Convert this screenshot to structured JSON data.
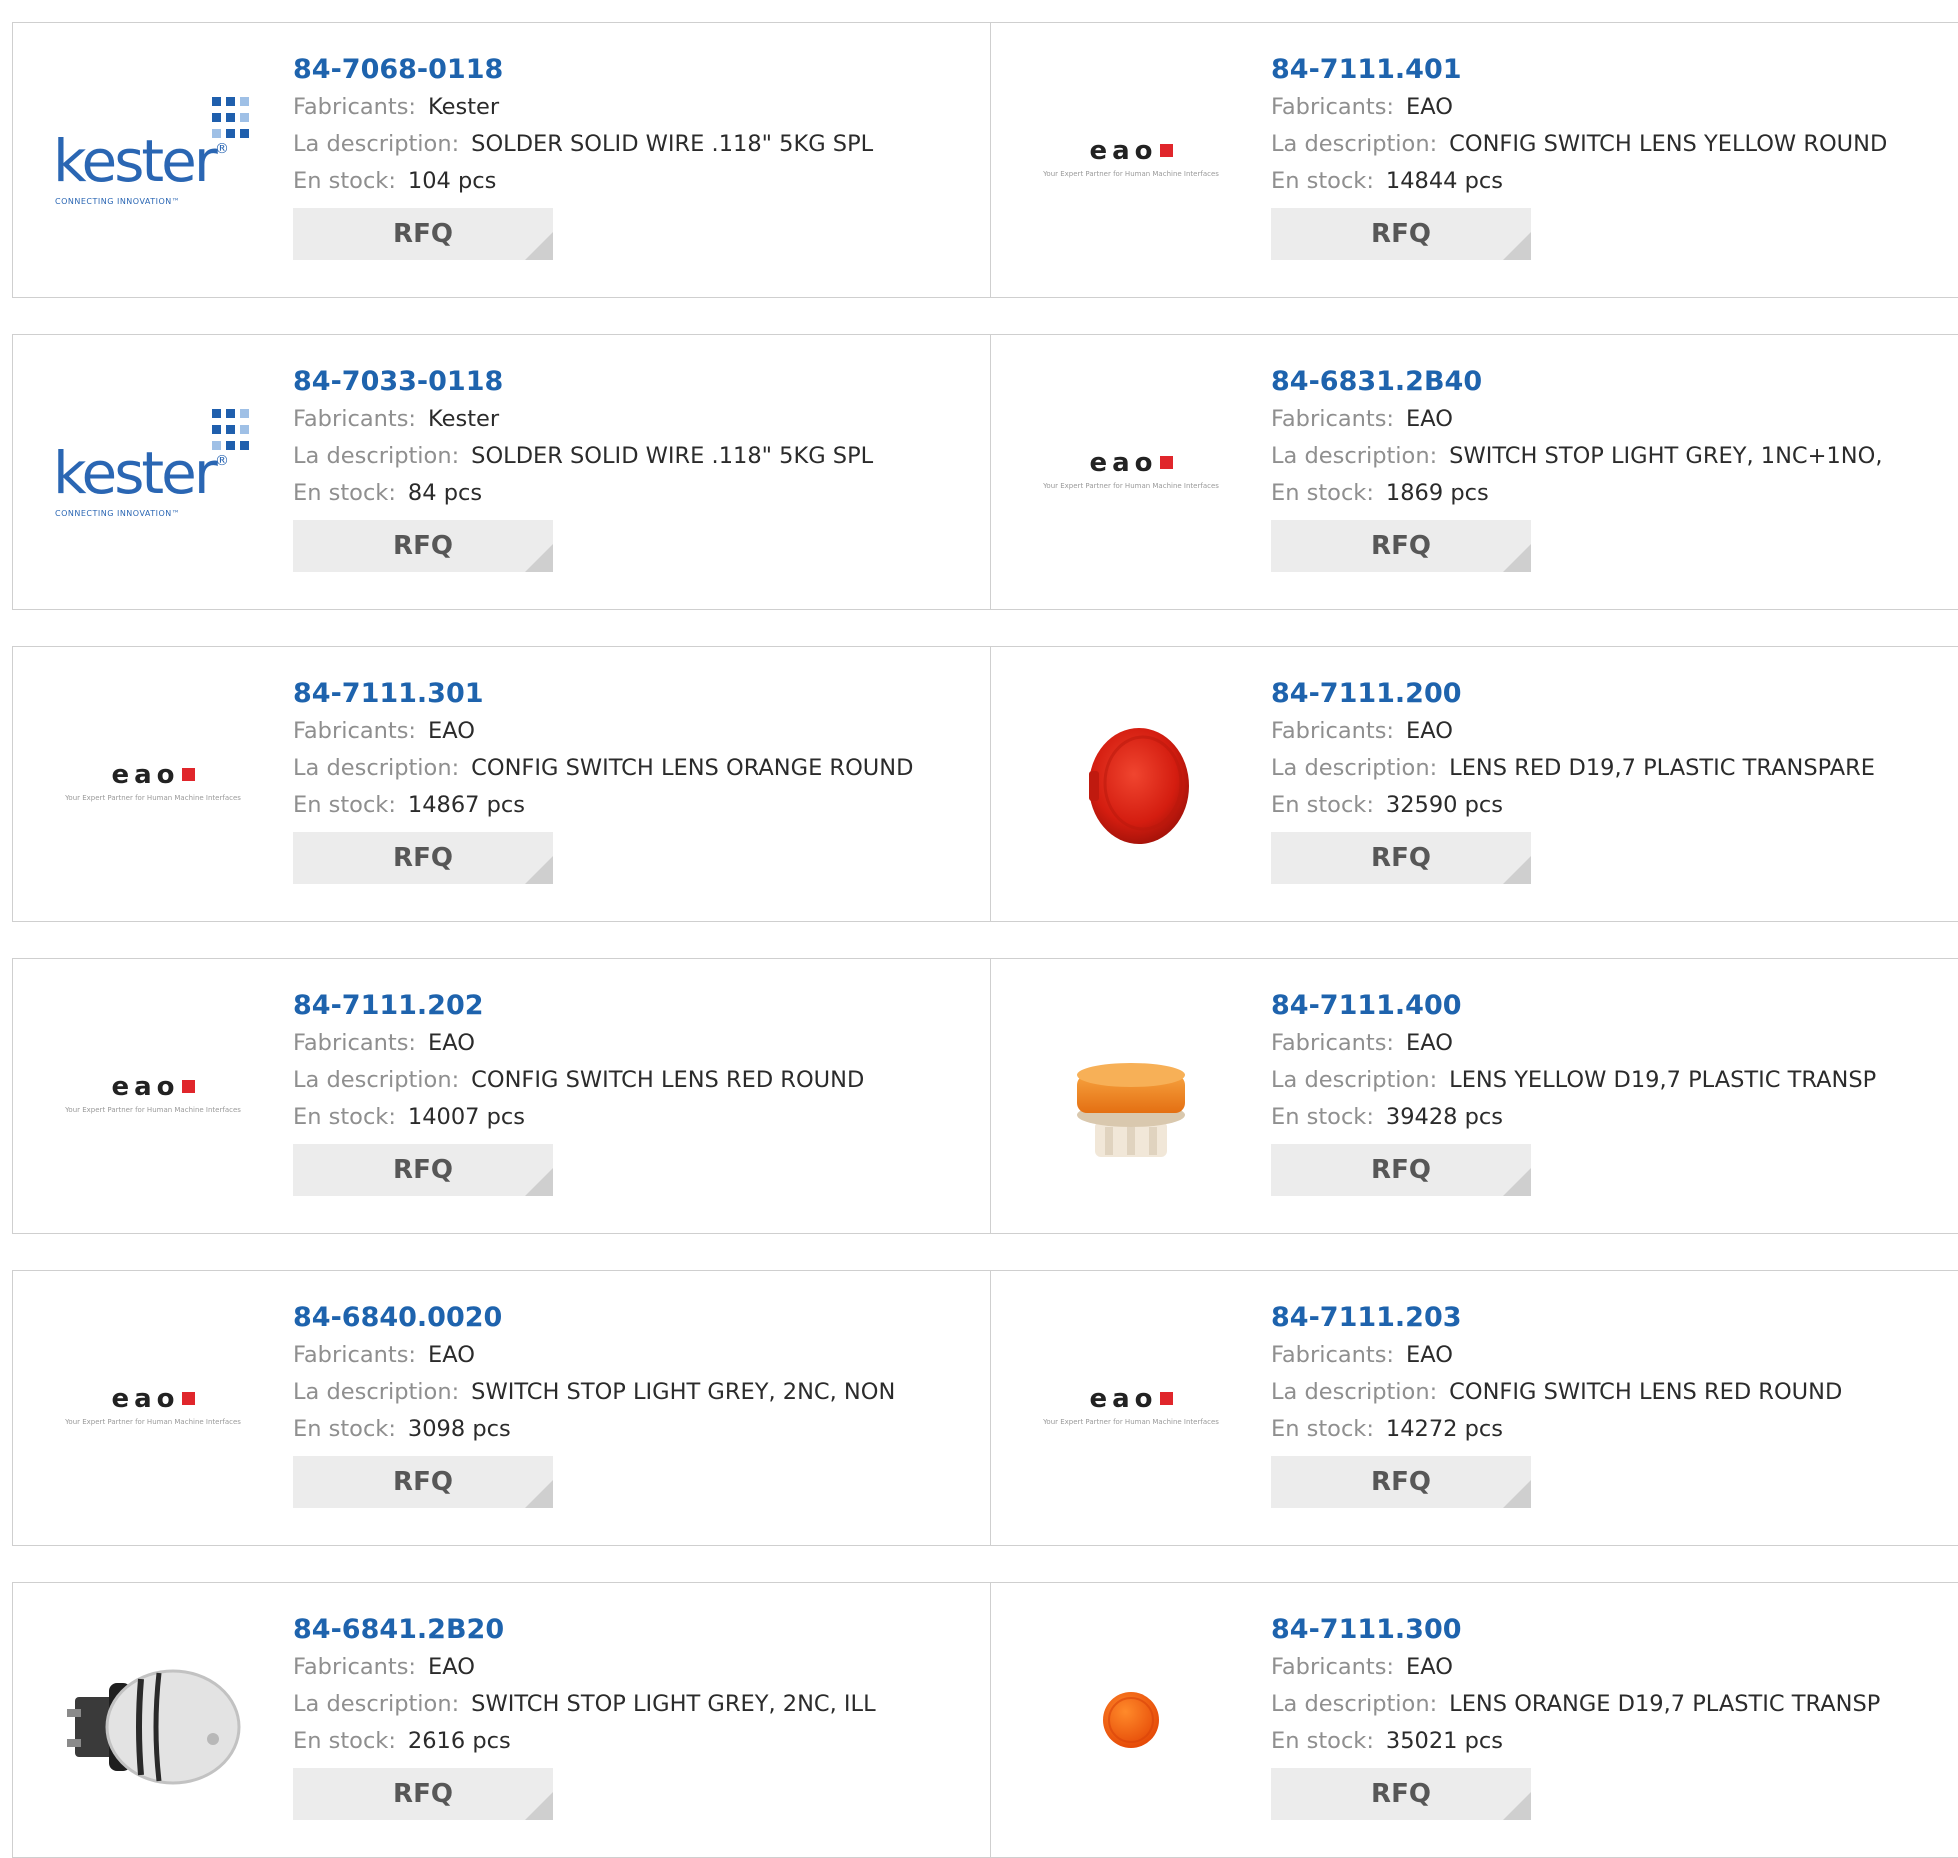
{
  "labels": {
    "manufacturer": "Fabricants:",
    "description": "La description:",
    "stock": "En stock:",
    "rfq": "RFQ"
  },
  "brand_colors": {
    "link": "#1e63ad",
    "kester_blue": "#2a66b3",
    "eao_red": "#e0262b"
  },
  "logos": {
    "kester": {
      "word": "kester",
      "reg": "®",
      "tagline": "CONNECTING INNOVATION™"
    },
    "eao": {
      "word": "eao",
      "tagline": "Your Expert Partner for Human Machine Interfaces"
    }
  },
  "products": [
    {
      "part": "84-7068-0118",
      "manufacturer": "Kester",
      "description": "SOLDER SOLID WIRE .118\" 5KG SPL",
      "stock": "104 pcs",
      "image": "kester-logo"
    },
    {
      "part": "84-7111.401",
      "manufacturer": "EAO",
      "description": "CONFIG SWITCH LENS YELLOW ROUND",
      "stock": "14844 pcs",
      "image": "eao-logo"
    },
    {
      "part": "84-7033-0118",
      "manufacturer": "Kester",
      "description": "SOLDER SOLID WIRE .118\" 5KG SPL",
      "stock": "84 pcs",
      "image": "kester-logo"
    },
    {
      "part": "84-6831.2B40",
      "manufacturer": "EAO",
      "description": "SWITCH STOP LIGHT GREY, 1NC+1NO,",
      "stock": "1869 pcs",
      "image": "eao-logo"
    },
    {
      "part": "84-7111.301",
      "manufacturer": "EAO",
      "description": "CONFIG SWITCH LENS ORANGE ROUND",
      "stock": "14867 pcs",
      "image": "eao-logo"
    },
    {
      "part": "84-7111.200",
      "manufacturer": "EAO",
      "description": "LENS RED D19,7 PLASTIC TRANSPARE",
      "stock": "32590 pcs",
      "image": "red-lens-photo"
    },
    {
      "part": "84-7111.202",
      "manufacturer": "EAO",
      "description": "CONFIG SWITCH LENS RED ROUND",
      "stock": "14007 pcs",
      "image": "eao-logo"
    },
    {
      "part": "84-7111.400",
      "manufacturer": "EAO",
      "description": "LENS YELLOW D19,7 PLASTIC TRANSP",
      "stock": "39428 pcs",
      "image": "yellow-lens-photo"
    },
    {
      "part": "84-6840.0020",
      "manufacturer": "EAO",
      "description": "SWITCH STOP LIGHT GREY, 2NC, NON",
      "stock": "3098 pcs",
      "image": "eao-logo"
    },
    {
      "part": "84-7111.203",
      "manufacturer": "EAO",
      "description": "CONFIG SWITCH LENS RED ROUND",
      "stock": "14272 pcs",
      "image": "eao-logo"
    },
    {
      "part": "84-6841.2B20",
      "manufacturer": "EAO",
      "description": "SWITCH STOP LIGHT GREY, 2NC, ILL",
      "stock": "2616 pcs",
      "image": "grey-switch-photo"
    },
    {
      "part": "84-7111.300",
      "manufacturer": "EAO",
      "description": "LENS ORANGE D19,7 PLASTIC TRANSP",
      "stock": "35021 pcs",
      "image": "orange-lens-photo"
    }
  ]
}
